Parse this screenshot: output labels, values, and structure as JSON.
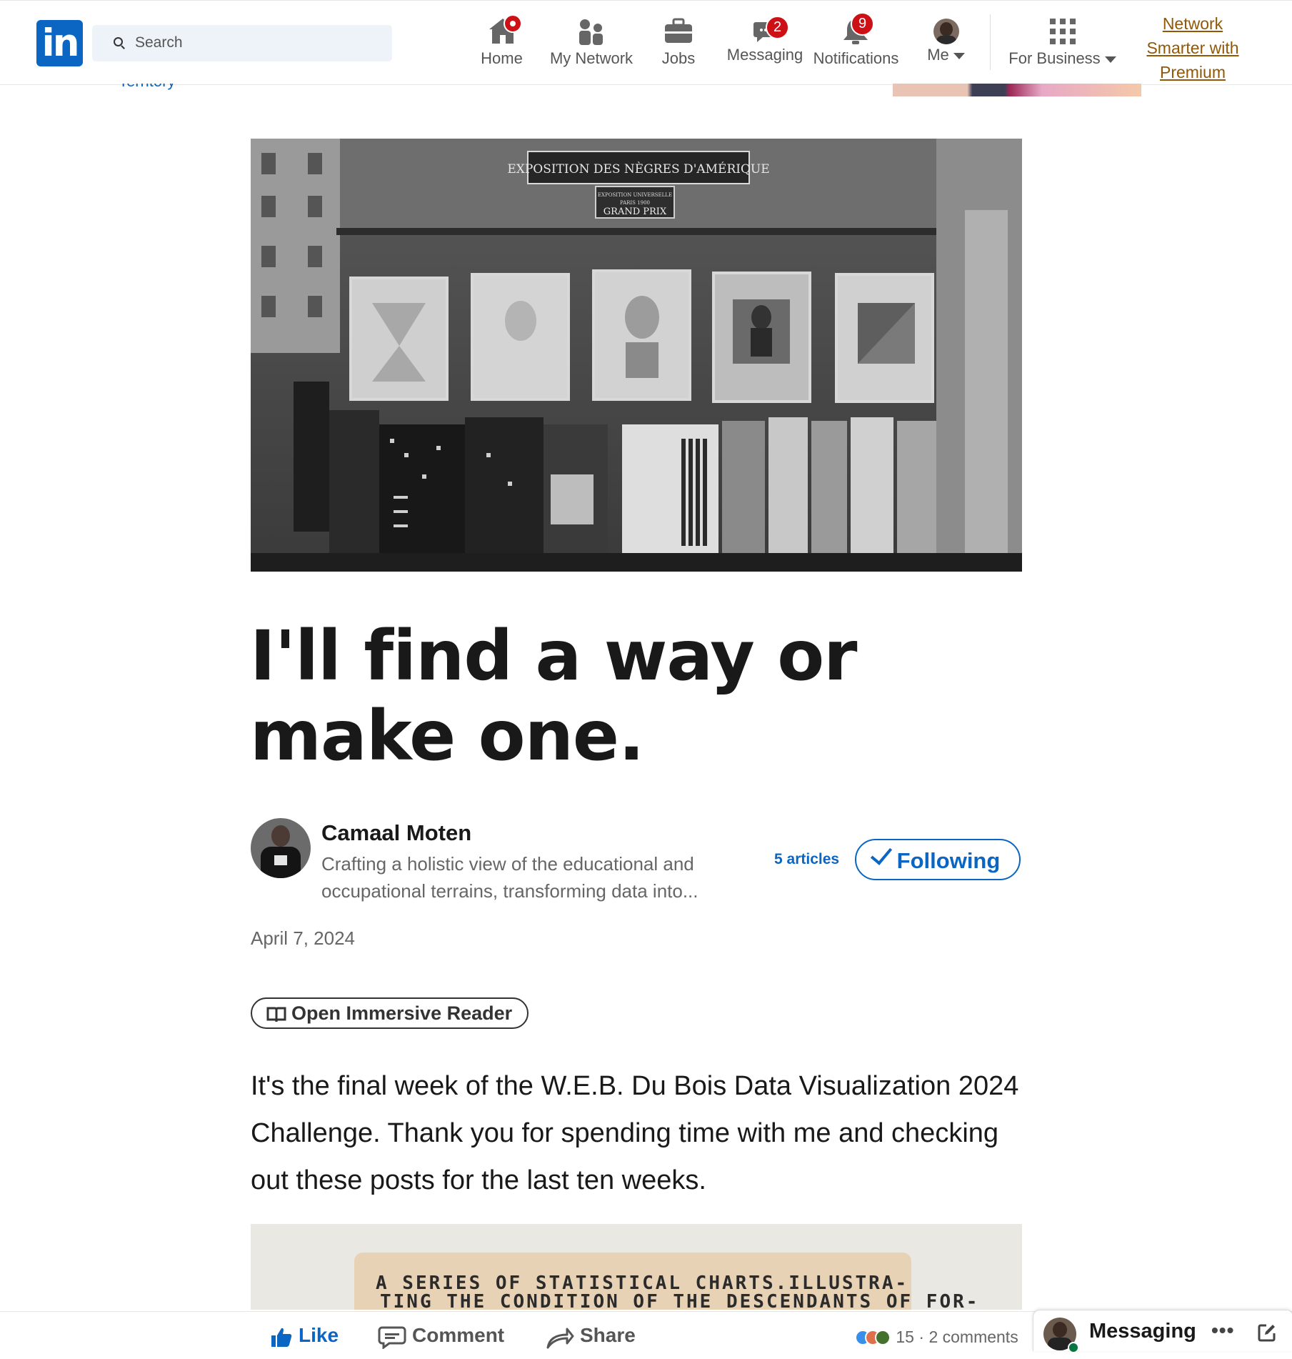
{
  "nav": {
    "search_placeholder": "Search",
    "items": [
      {
        "label": "Home"
      },
      {
        "label": "My Network"
      },
      {
        "label": "Jobs"
      },
      {
        "label": "Messaging",
        "badge": "2"
      },
      {
        "label": "Notifications",
        "badge": "9"
      },
      {
        "label": "Me"
      },
      {
        "label": "For Business"
      }
    ],
    "premium_link": [
      "Network",
      "Smarter with",
      "Premium"
    ]
  },
  "hero_image": {
    "sign": "EXPOSITION DES NÈGRES D'AMÉRIQUE",
    "plaque": [
      "EXPOSITION UNIVERSELLE",
      "PARIS 1900",
      "GRAND PRIX"
    ]
  },
  "article": {
    "title": "I'll find a way or make one.",
    "author": {
      "name": "Camaal Moten",
      "headline": "Crafting a holistic view of the educational and occupational terrains, transforming data into..."
    },
    "articles_count": "5 articles",
    "follow_label": "Following",
    "date": "April 7, 2024",
    "immersive_reader": "Open Immersive Reader",
    "paragraph": "It's the final week of the W.E.B. Du Bois Data Visualization 2024 Challenge. Thank you for spending time with me and checking out these posts for the last ten weeks.",
    "image2_text": [
      "A SERIES OF STATISTICAL CHARTS.ILLUSTRA-",
      "TING THE CONDITION OF THE DESCENDANTS OF FOR-"
    ]
  },
  "actions": {
    "like": "Like",
    "comment": "Comment",
    "share": "Share",
    "reactions": "15",
    "comments": "2 comments"
  },
  "messaging_dock": {
    "label": "Messaging",
    "more": "•••"
  },
  "colors": {
    "brand": "#0a66c2",
    "badge": "#cc1016",
    "premium": "#915907"
  }
}
